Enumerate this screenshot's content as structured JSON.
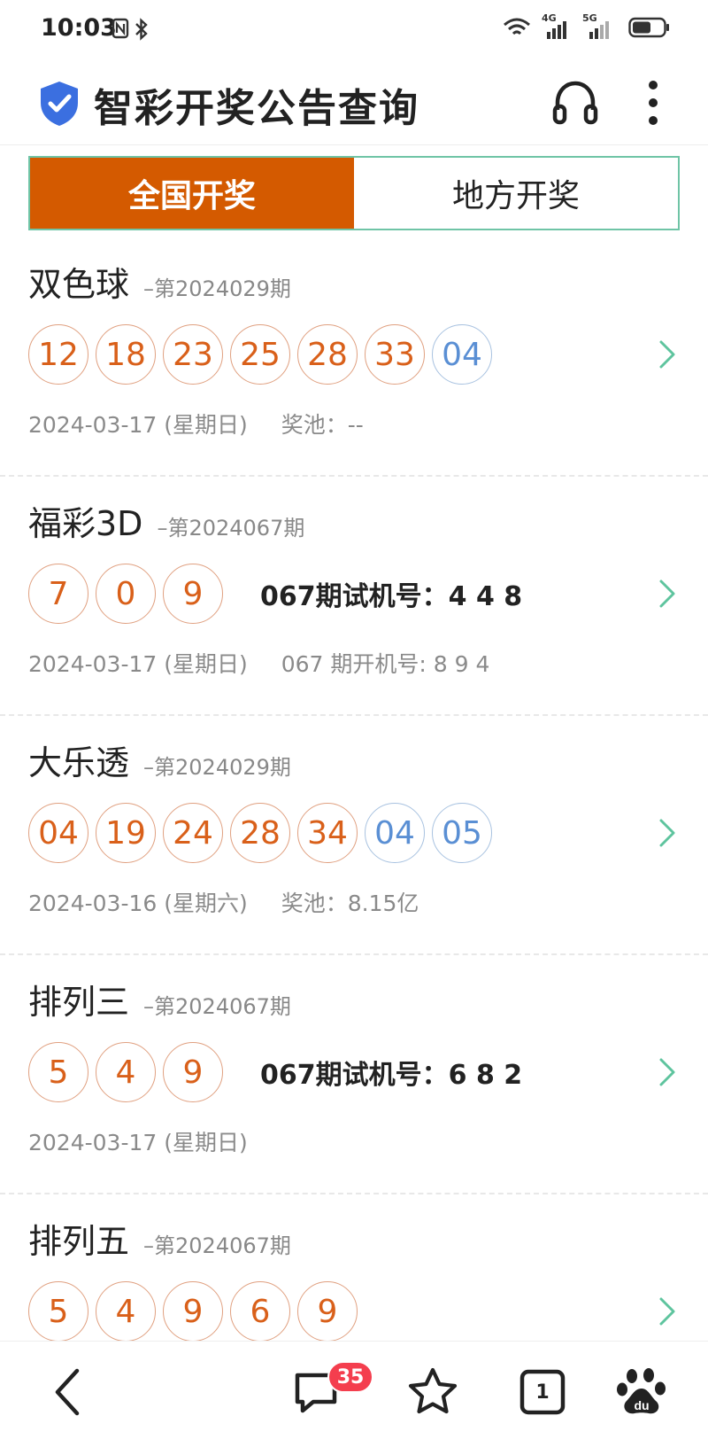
{
  "status_bar": {
    "time": "10:03",
    "net_4g": "4G",
    "net_5g": "5G"
  },
  "app_bar": {
    "title": "智彩开奖公告查询",
    "icons": [
      "shield-check-icon",
      "headset-icon",
      "more-vertical-icon"
    ]
  },
  "tabs": [
    {
      "label": "全国开奖",
      "active": true
    },
    {
      "label": "地方开奖",
      "active": false
    }
  ],
  "colors": {
    "accent": "#d45a00",
    "red_ball": "#d9601a",
    "blue_ball": "#5a8fd4",
    "tab_border": "#6fc4a6",
    "badge": "#f43e4e"
  },
  "lotteries": [
    {
      "name": "双色球",
      "issue": "–第2024029期",
      "red": [
        "12",
        "18",
        "23",
        "25",
        "28",
        "33"
      ],
      "blue": [
        "04"
      ],
      "trial": "",
      "date": "2024-03-17 (星期日)",
      "extra": "奖池：--"
    },
    {
      "name": "福彩3D",
      "issue": "–第2024067期",
      "red": [
        "7",
        "0",
        "9"
      ],
      "blue": [],
      "trial": "067期试机号：4 4 8",
      "date": "2024-03-17 (星期日)",
      "extra": "067 期开机号: 8 9 4"
    },
    {
      "name": "大乐透",
      "issue": "–第2024029期",
      "red": [
        "04",
        "19",
        "24",
        "28",
        "34"
      ],
      "blue": [
        "04",
        "05"
      ],
      "trial": "",
      "date": "2024-03-16 (星期六)",
      "extra": "奖池：8.15亿"
    },
    {
      "name": "排列三",
      "issue": "–第2024067期",
      "red": [
        "5",
        "4",
        "9"
      ],
      "blue": [],
      "trial": "067期试机号：6 8 2",
      "date": "2024-03-17 (星期日)",
      "extra": ""
    },
    {
      "name": "排列五",
      "issue": "–第2024067期",
      "red": [
        "5",
        "4",
        "9",
        "6",
        "9"
      ],
      "blue": [],
      "trial": "",
      "date": "",
      "extra": ""
    }
  ],
  "bottom_nav": {
    "messages_badge": "35",
    "tab_count": "1",
    "icons": [
      "back-arrow-icon",
      "chat-bubble-icon",
      "star-icon",
      "tabs-icon",
      "baidu-paw-icon"
    ]
  }
}
